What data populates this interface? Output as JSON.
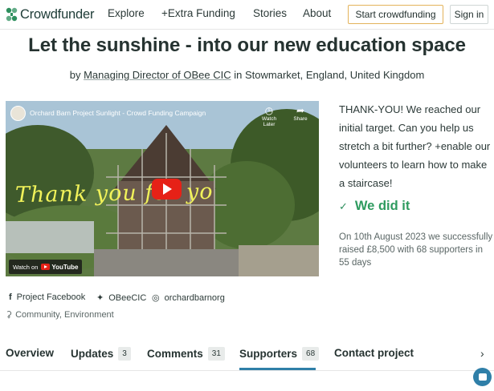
{
  "brand": {
    "name": "Crowdfunder",
    "color": "#2e8f5e"
  },
  "nav": {
    "items": [
      {
        "label": "Explore"
      },
      {
        "label": "+Extra Funding"
      },
      {
        "label": "Stories"
      },
      {
        "label": "About"
      }
    ],
    "start_button": "Start crowdfunding",
    "signin_button": "Sign in"
  },
  "project": {
    "title": "Let the sunshine - into our new education space",
    "by_prefix": "by",
    "owner": "Managing Director of OBee CIC",
    "location_prefix": "in",
    "location": "Stowmarket, England, United Kingdom"
  },
  "video": {
    "title": "Orchard Barn Project Sunlight - Crowd Funding Campaign",
    "watch_later": "Watch Later",
    "share": "Share",
    "overlay_text": "Thank you for yo",
    "watch_on": "Watch on",
    "youtube": "YouTube"
  },
  "side": {
    "thanks_message": "THANK-YOU! We reached our initial target. Can you help us stretch a bit further? +enable our volunteers to learn how to make a staircase!",
    "status": "We did it",
    "success_text": "On 10th August 2023 we successfully raised £8,500 with 68 supporters in 55 days"
  },
  "social": {
    "facebook": "Project Facebook",
    "twitter": "OBeeCIC",
    "instagram": "orchardbarnorg",
    "categories": "Community, Environment"
  },
  "tabs": [
    {
      "label": "Overview",
      "count": null
    },
    {
      "label": "Updates",
      "count": "3"
    },
    {
      "label": "Comments",
      "count": "31"
    },
    {
      "label": "Supporters",
      "count": "68"
    },
    {
      "label": "Contact project",
      "count": null
    }
  ],
  "active_tab": "Supporters",
  "accent_color": "#2f7fa8",
  "button_border_color": "#e3b35a"
}
